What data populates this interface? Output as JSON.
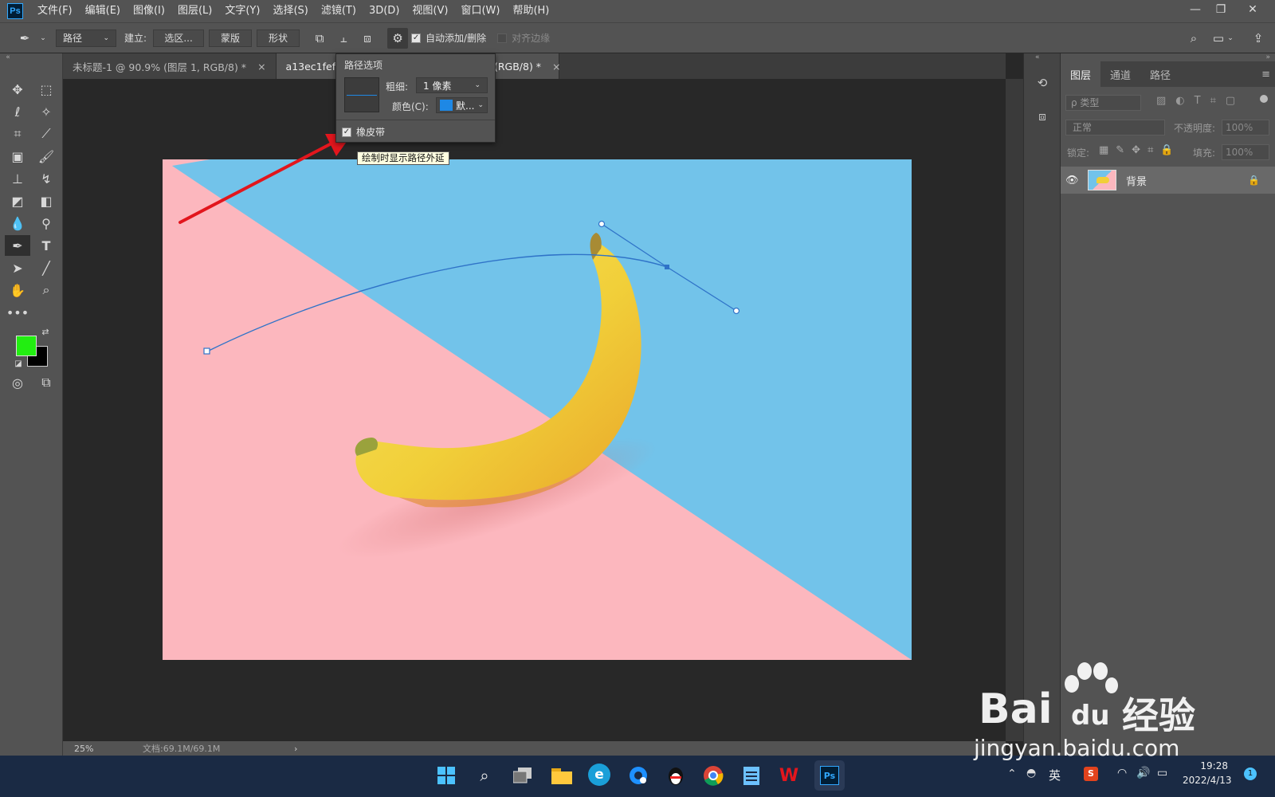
{
  "app": {
    "logo": "Ps"
  },
  "menu": [
    "文件(F)",
    "编辑(E)",
    "图像(I)",
    "图层(L)",
    "文字(Y)",
    "选择(S)",
    "滤镜(T)",
    "3D(D)",
    "视图(V)",
    "窗口(W)",
    "帮助(H)"
  ],
  "options": {
    "mode": "路径",
    "build_label": "建立:",
    "btn_selection": "选区...",
    "btn_mask": "蒙版",
    "btn_shape": "形状",
    "auto_add": "自动添加/删除",
    "align_edges": "对齐边缘"
  },
  "tabs": [
    {
      "title": "未标题-1 @ 90.9% (图层 1, RGB/8) *",
      "close": "×"
    },
    {
      "title": "a13ec1fef2d",
      "close": ""
    },
    {
      "title": "6(RGB/8) *",
      "close": "×"
    }
  ],
  "popup": {
    "title": "路径选项",
    "weight_label": "粗细:",
    "weight_value": "1 像素",
    "color_label": "颜色(C):",
    "color_value": "默...",
    "color_swatch": "#1e88e5",
    "rubber_band": "橡皮带"
  },
  "tooltip": "绘制时显示路径外延",
  "status": {
    "zoom": "25%",
    "doc": "文档:69.1M/69.1M",
    "arrow": "›"
  },
  "panel": {
    "tabs": [
      "图层",
      "通道",
      "路径"
    ],
    "filter": "ρ 类型",
    "blend": "正常",
    "opacity_label": "不透明度:",
    "opacity": "100%",
    "lock_label": "锁定:",
    "fill_label": "填充:",
    "fill": "100%",
    "layer_name": "背景"
  },
  "colors": {
    "foreground": "#22ee11",
    "background": "#000000"
  },
  "taskbar": {
    "ime": "英",
    "time": "19:28",
    "date": "2022/4/13",
    "badge": "1"
  },
  "watermark": {
    "brand": "Bai",
    "brand2": "du",
    "cn": "经验",
    "url": "jingyan.baidu.com"
  }
}
